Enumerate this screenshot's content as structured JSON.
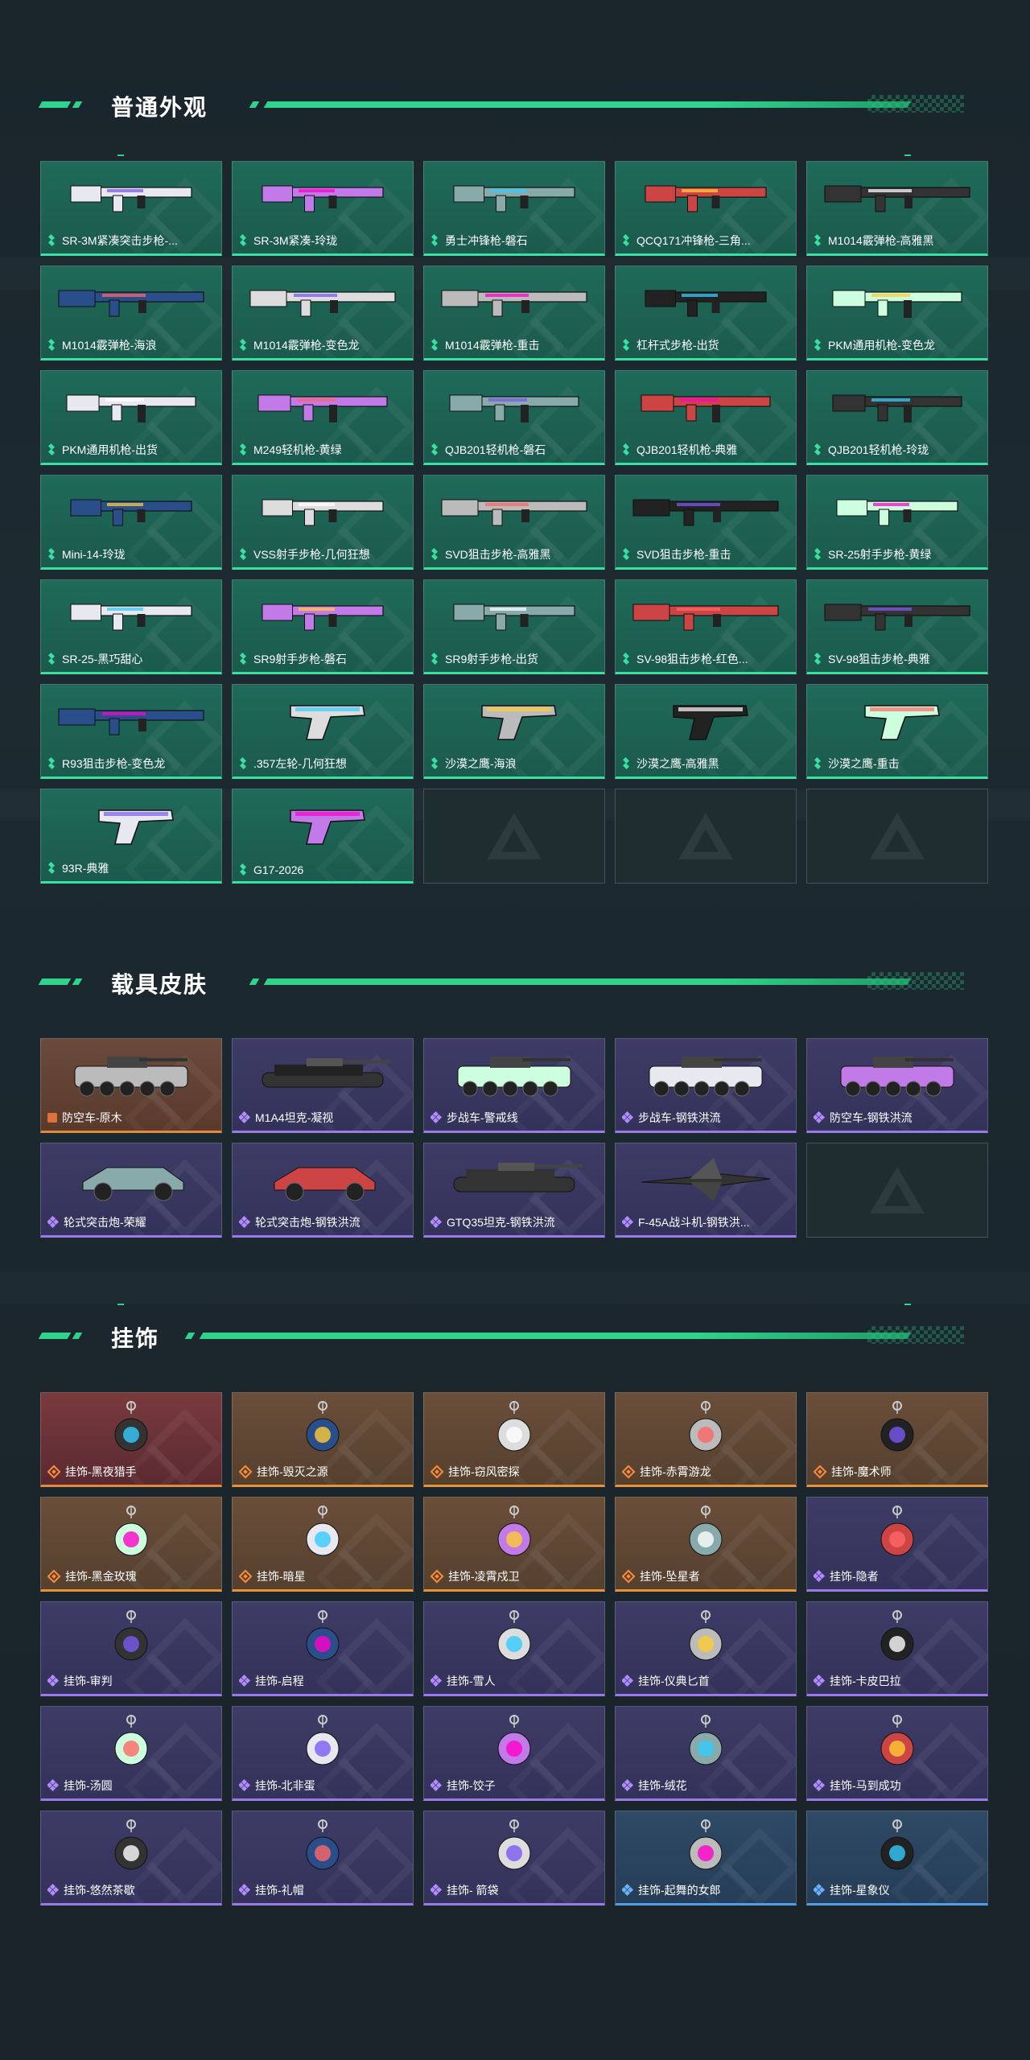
{
  "sections": [
    {
      "title": "普通外观",
      "items": [
        {
          "label": "SR-3M紧凑突击步枪-...",
          "kind": "smg"
        },
        {
          "label": "SR-3M紧凑-玲珑",
          "kind": "smg"
        },
        {
          "label": "勇士冲锋枪-磐石",
          "kind": "smg"
        },
        {
          "label": "QCQ171冲锋枪-三角...",
          "kind": "smg"
        },
        {
          "label": "M1014霰弹枪-高雅黑",
          "kind": "shotgun"
        },
        {
          "label": "M1014霰弹枪-海浪",
          "kind": "shotgun"
        },
        {
          "label": "M1014霰弹枪-变色龙",
          "kind": "shotgun"
        },
        {
          "label": "M1014霰弹枪-重击",
          "kind": "shotgun"
        },
        {
          "label": "杠杆式步枪-出货",
          "kind": "rifle"
        },
        {
          "label": "PKM通用机枪-变色龙",
          "kind": "lmg"
        },
        {
          "label": "PKM通用机枪-出货",
          "kind": "lmg"
        },
        {
          "label": "M249轻机枪-黄绿",
          "kind": "lmg"
        },
        {
          "label": "QJB201轻机枪-磐石",
          "kind": "lmg"
        },
        {
          "label": "QJB201轻机枪-典雅",
          "kind": "lmg"
        },
        {
          "label": "QJB201轻机枪-玲珑",
          "kind": "lmg"
        },
        {
          "label": "Mini-14-玲珑",
          "kind": "rifle"
        },
        {
          "label": "VSS射手步枪-几何狂想",
          "kind": "rifle"
        },
        {
          "label": "SVD狙击步枪-高雅黑",
          "kind": "sniper"
        },
        {
          "label": "SVD狙击步枪-重击",
          "kind": "sniper"
        },
        {
          "label": "SR-25射手步枪-黄绿",
          "kind": "rifle"
        },
        {
          "label": "SR-25-黑巧甜心",
          "kind": "rifle"
        },
        {
          "label": "SR9射手步枪-磐石",
          "kind": "rifle"
        },
        {
          "label": "SR9射手步枪-出货",
          "kind": "rifle"
        },
        {
          "label": "SV-98狙击步枪-红色...",
          "kind": "sniper"
        },
        {
          "label": "SV-98狙击步枪-典雅",
          "kind": "sniper"
        },
        {
          "label": "R93狙击步枪-变色龙",
          "kind": "sniper"
        },
        {
          "label": ".357左轮-几何狂想",
          "kind": "revolver"
        },
        {
          "label": "沙漠之鹰-海浪",
          "kind": "pistol"
        },
        {
          "label": "沙漠之鹰-高雅黑",
          "kind": "pistol"
        },
        {
          "label": "沙漠之鹰-重击",
          "kind": "pistol"
        },
        {
          "label": "93R-典雅",
          "kind": "pistol"
        },
        {
          "label": "G17-2026",
          "kind": "pistol"
        }
      ]
    },
    {
      "title": "载具皮肤",
      "items": [
        {
          "label": "防空车-原木",
          "kind": "apc"
        },
        {
          "label": "M1A4坦克-凝视",
          "kind": "tank"
        },
        {
          "label": "步战车-警戒线",
          "kind": "apc"
        },
        {
          "label": "步战车-钢铁洪流",
          "kind": "apc"
        },
        {
          "label": "防空车-钢铁洪流",
          "kind": "apc"
        },
        {
          "label": "轮式突击炮-荣耀",
          "kind": "buggy"
        },
        {
          "label": "轮式突击炮-钢铁洪流",
          "kind": "buggy"
        },
        {
          "label": "GTQ35坦克-钢铁洪流",
          "kind": "tank"
        },
        {
          "label": "F-45A战斗机-钢铁洪...",
          "kind": "jet"
        }
      ]
    },
    {
      "title": "挂饰",
      "items": [
        {
          "label": "挂饰-黑夜猎手"
        },
        {
          "label": "挂饰-毁灭之源"
        },
        {
          "label": "挂饰-窃风密探"
        },
        {
          "label": "挂饰-赤霄游龙"
        },
        {
          "label": "挂饰-魔术师"
        },
        {
          "label": "挂饰-黑金玫瑰"
        },
        {
          "label": "挂饰-暗星"
        },
        {
          "label": "挂饰-凌霄戍卫"
        },
        {
          "label": "挂饰-坠星者"
        },
        {
          "label": "挂饰-隐者"
        },
        {
          "label": "挂饰-审判"
        },
        {
          "label": "挂饰-启程"
        },
        {
          "label": "挂饰-雪人"
        },
        {
          "label": "挂饰-仪典匕首"
        },
        {
          "label": "挂饰-卡皮巴拉"
        },
        {
          "label": "挂饰-汤圆"
        },
        {
          "label": "挂饰-北非蛋"
        },
        {
          "label": "挂饰-饺子"
        },
        {
          "label": "挂饰-绒花"
        },
        {
          "label": "挂饰-马到成功"
        },
        {
          "label": "挂饰-悠然茶歇"
        },
        {
          "label": "挂饰-礼帽"
        },
        {
          "label": "挂饰- 箭袋"
        },
        {
          "label": "挂饰-起舞的女郎"
        },
        {
          "label": "挂饰-星象仪"
        }
      ]
    }
  ],
  "colors": {
    "accent": "#2fd38b",
    "green_card": "#1f6a5a",
    "purple_card": "#3e3c66",
    "orange_card": "#6a4e3a",
    "red_card": "#7a3a3e",
    "blue_card": "#2e4a66"
  }
}
